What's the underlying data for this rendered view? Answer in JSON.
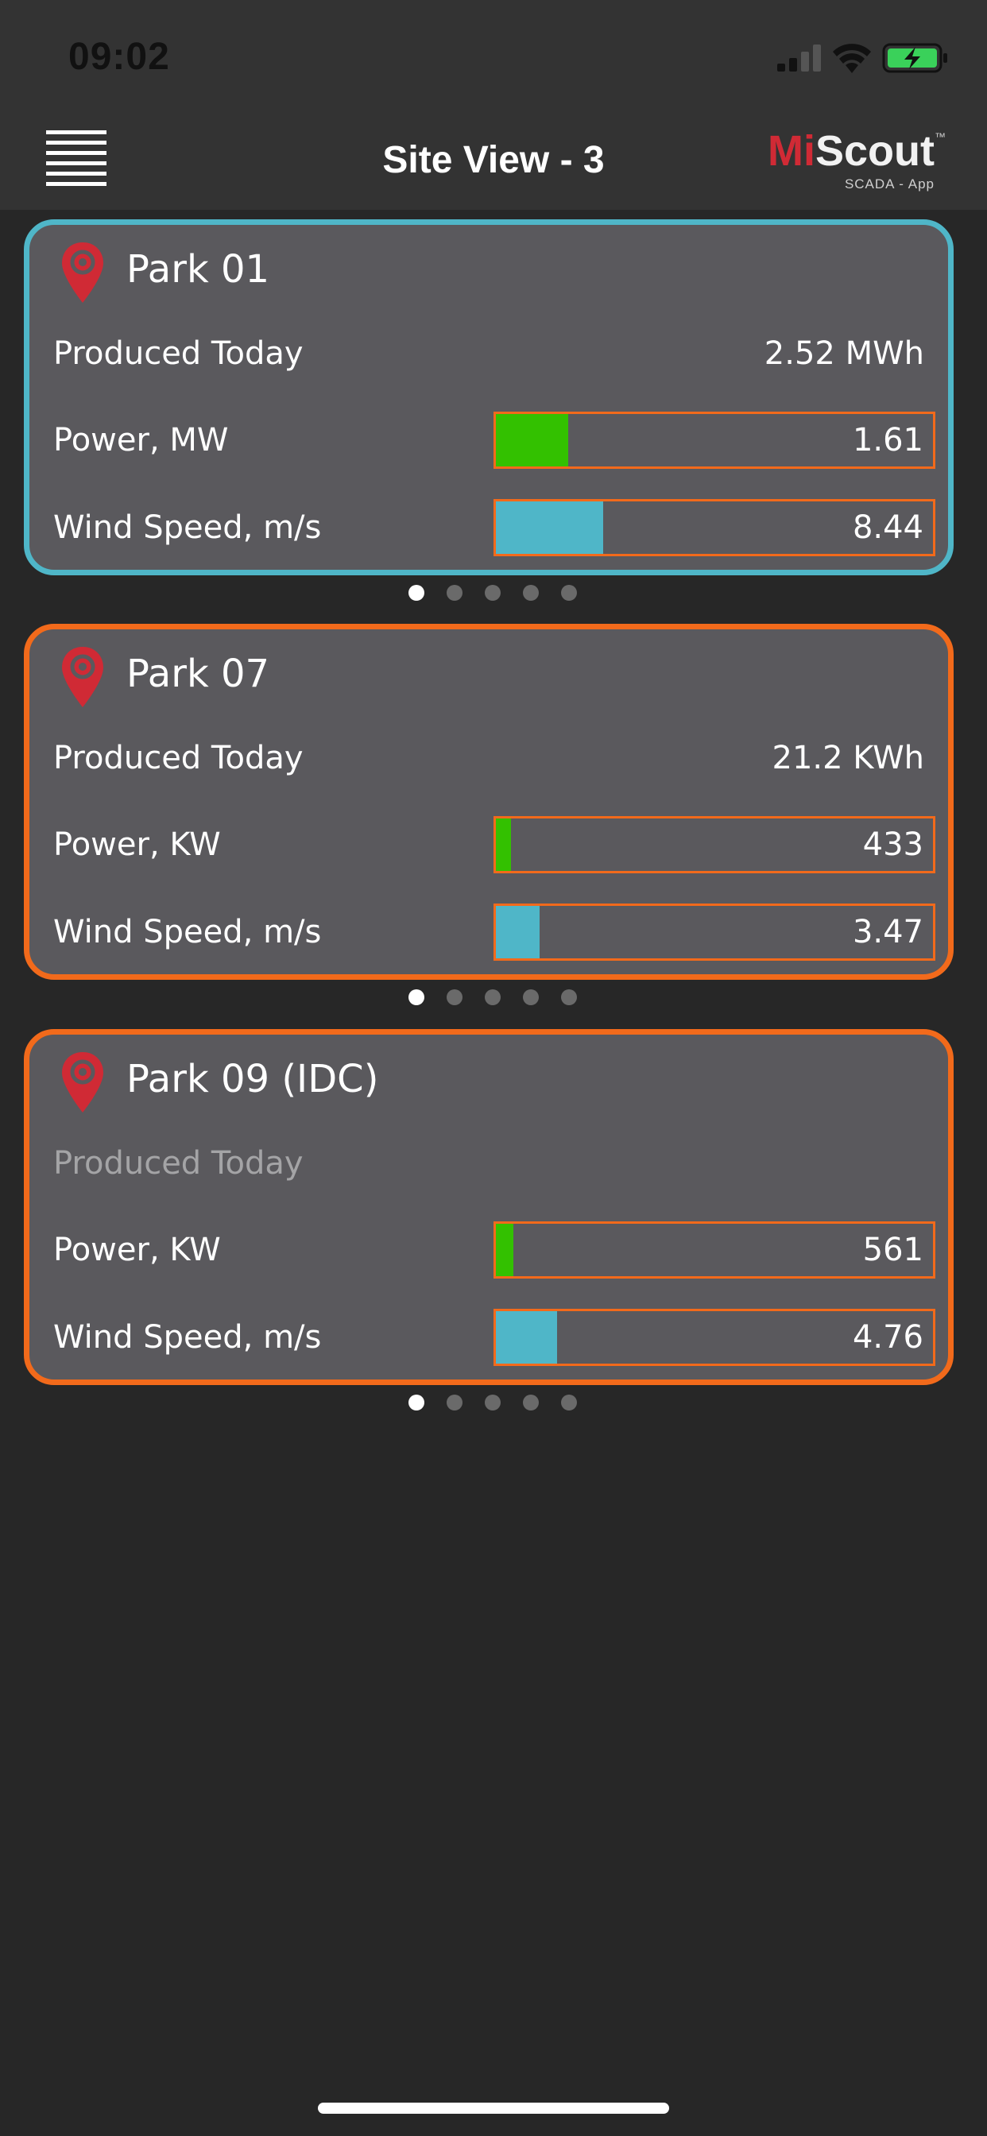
{
  "status_bar": {
    "time": "09:02",
    "icons": [
      "signal-icon",
      "wifi-icon",
      "battery-charging-icon"
    ]
  },
  "header": {
    "title": "Site View - 3",
    "menu_icon": "hamburger-menu-icon",
    "logo": {
      "mi": "Mi",
      "scout": "Scout",
      "tm": "™",
      "subtitle": "SCADA - App"
    }
  },
  "colors": {
    "selected_border": "#4fb6c8",
    "card_border": "#f26a1b",
    "power_fill": "#33c100",
    "wind_fill": "#4fb6c8",
    "pin": "#d02a35"
  },
  "cards": [
    {
      "title": "Park 01",
      "selected": true,
      "produced_label": "Produced Today",
      "produced_value": "2.52 MWh",
      "power_label": "Power, MW",
      "power_value": "1.61",
      "power_fraction": 0.165,
      "wind_label": "Wind Speed, m/s",
      "wind_value": "8.44",
      "wind_fraction": 0.245,
      "page_dots": 5,
      "active_dot": 0
    },
    {
      "title": "Park 07",
      "selected": false,
      "produced_label": "Produced Today",
      "produced_value": "21.2 KWh",
      "power_label": "Power, KW",
      "power_value": "433",
      "power_fraction": 0.035,
      "wind_label": "Wind Speed, m/s",
      "wind_value": "3.47",
      "wind_fraction": 0.1,
      "page_dots": 5,
      "active_dot": 0
    },
    {
      "title": "Park 09 (IDC)",
      "selected": false,
      "produced_label": "Produced Today",
      "produced_value": "",
      "produced_muted": true,
      "power_label": "Power, KW",
      "power_value": "561",
      "power_fraction": 0.04,
      "wind_label": "Wind Speed, m/s",
      "wind_value": "4.76",
      "wind_fraction": 0.14,
      "page_dots": 5,
      "active_dot": 0
    }
  ]
}
